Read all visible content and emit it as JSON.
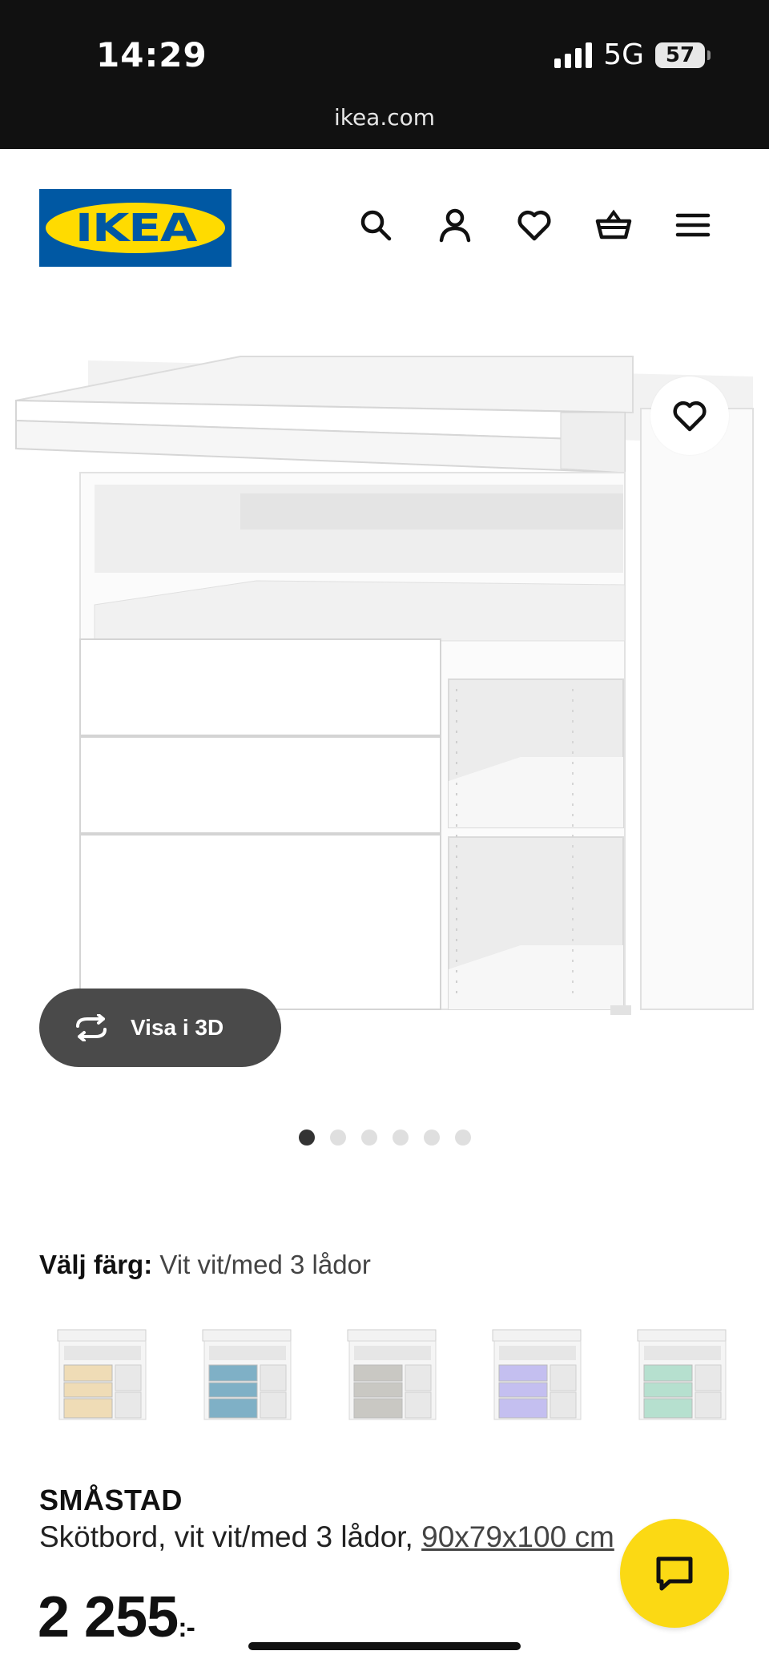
{
  "status_bar": {
    "time": "14:29",
    "network": "5G",
    "battery": "57"
  },
  "browser": {
    "url": "ikea.com"
  },
  "header": {
    "logo_text": "IKEA",
    "icons": [
      "search-icon",
      "account-icon",
      "heart-icon",
      "basket-icon",
      "menu-icon"
    ]
  },
  "gallery": {
    "view_3d_label": "Visa i 3D",
    "image_count": 6,
    "active_index": 0
  },
  "color_selector": {
    "label": "Välj färg:",
    "value": "Vit vit/med 3 lådor",
    "swatch_drawer_colors": [
      "#efdcb6",
      "#7fb0c6",
      "#c9c8c3",
      "#c4bff0",
      "#b6e0cf"
    ]
  },
  "product": {
    "name": "SMÅSTAD",
    "description": "Skötbord, vit vit/med 3 lådor,",
    "dimensions": "90x79x100 cm",
    "price": "2 255",
    "price_suffix": ":-"
  },
  "colors": {
    "ikea_blue": "#0058a3",
    "ikea_yellow": "#ffdb00",
    "chat_yellow": "#fbd914"
  }
}
